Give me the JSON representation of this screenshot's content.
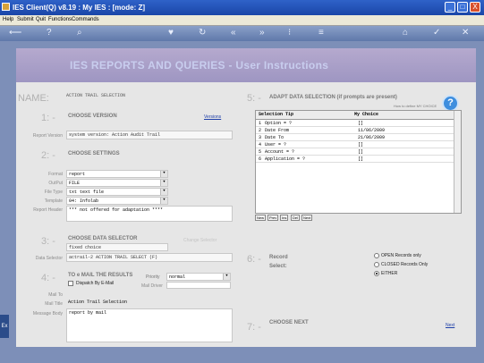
{
  "window": {
    "title": "IES Client(Q) v8.19 : My IES :         [mode: Z]",
    "buttons": [
      "_",
      "□",
      "X"
    ]
  },
  "menu": [
    "Help",
    "Submit",
    "Quit",
    "Functions",
    "Commands"
  ],
  "toolbar": {
    "icons": [
      "back-arrow-icon",
      "help-icon",
      "search-icon",
      "heart-icon",
      "refresh-icon",
      "rewind-icon",
      "forward-icon",
      "grid-icon",
      "menu-icon",
      "home-icon",
      "check-icon",
      "close-icon"
    ]
  },
  "banner": {
    "title": "IES REPORTS AND QUERIES -  User Instructions"
  },
  "name_section": {
    "label": "NAME:",
    "value": "ACTION TRAIL SELECTION"
  },
  "s1": {
    "num": "1: -",
    "title": "CHOOSE VERSION",
    "link": "Versions",
    "field_label": "Report Version",
    "value": "system version: Action Audit Trail"
  },
  "s2": {
    "num": "2: -",
    "title": "CHOOSE SETTINGS",
    "format_label": "Format",
    "format": "report",
    "output_label": "OutPut",
    "output": "FILE",
    "filetype_label": "File Type",
    "filetype": "txt text file",
    "template_label": "Template",
    "template": "04: Infolab",
    "header_label": "Report Header",
    "header": "*** not offered for adaptation ****"
  },
  "s3": {
    "num": "3: -",
    "title": "CHOOSE DATA SELECTOR",
    "link": "Change Selector",
    "value1": "fixed choice",
    "field_label": "Data Selector",
    "value2": "actrail-2 ACTION TRAIL SELECT (F)"
  },
  "s4": {
    "num": "4: -",
    "title": "TO e MAIL THE RESULTS",
    "priority_label": "Priority",
    "priority": "normal",
    "dispatch_label": "Dispatch By E-Mail",
    "mail_driver_label": "Mail Driver",
    "mailto_label": "Mail To",
    "mailtitle_label": "Mail Title",
    "mailtitle": "Action Trail Selection",
    "body_label": "Message Body",
    "body": "report by mail"
  },
  "s5": {
    "num": "5: -",
    "title": "ADAPT DATA SELECTION (if prompts are present)",
    "help_link": "How to define MY CHOICE",
    "col1": "Selection Tip",
    "col2": "My Choice",
    "rows": [
      {
        "n": "1",
        "tip": "Option = ?",
        "choice": "[]"
      },
      {
        "n": "2",
        "tip": "Date From",
        "choice": "11/06/2009"
      },
      {
        "n": "3",
        "tip": "Date To",
        "choice": "21/06/2009"
      },
      {
        "n": "4",
        "tip": "User = ?",
        "choice": "[]"
      },
      {
        "n": "5",
        "tip": "Account = ?",
        "choice": "[]"
      },
      {
        "n": "6",
        "tip": "Application = ?",
        "choice": "[]"
      }
    ],
    "grid_buttons": [
      "New",
      "Prev",
      "Ins",
      "Del",
      "Next"
    ]
  },
  "s6": {
    "num": "6: -",
    "title1": "Record",
    "title2": "Select:",
    "options": [
      "OPEN Records only",
      "CLOSED Records Only",
      "EITHER"
    ],
    "selected": "EITHER"
  },
  "s7": {
    "num": "7: -",
    "title": "CHOOSE NEXT",
    "link": "Next"
  }
}
